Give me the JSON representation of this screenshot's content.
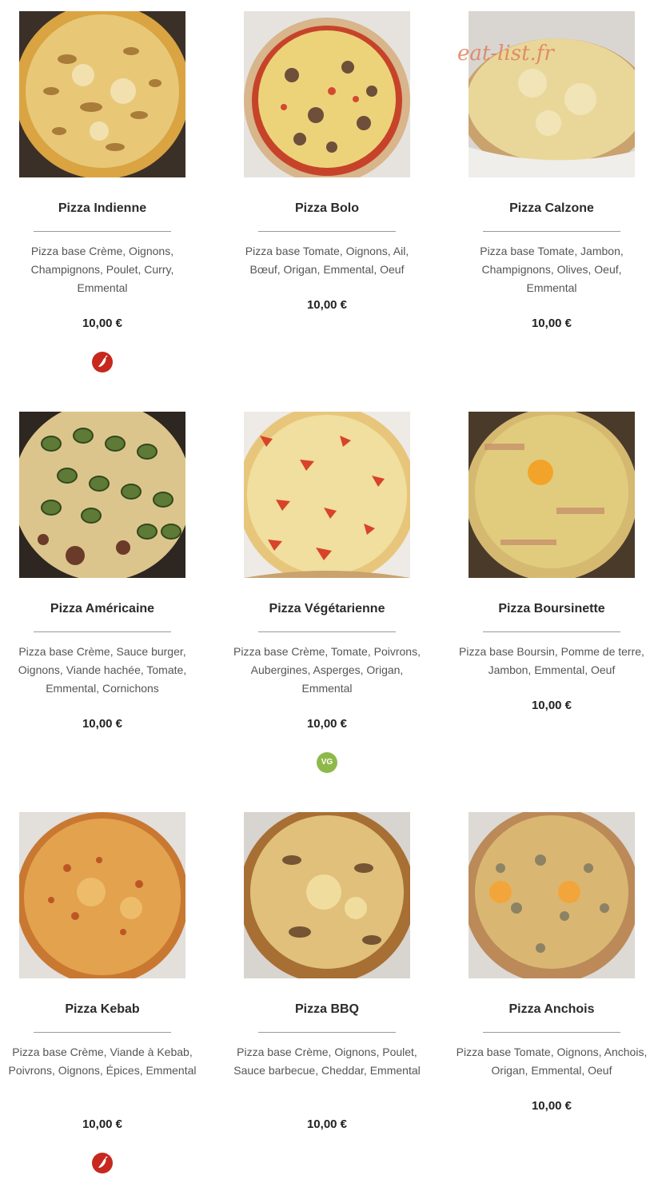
{
  "watermark": "eat-list.fr",
  "colors": {
    "spicy_badge": "#c7281e",
    "veg_badge": "#8fb84a"
  },
  "pizzas": [
    {
      "name": "Pizza Indienne",
      "description": "Pizza base Crème, Oignons, Champignons, Poulet, Curry, Emmental",
      "price": "10,00 €",
      "badge": "chili-icon"
    },
    {
      "name": "Pizza Bolo",
      "description": "Pizza base Tomate, Oignons, Ail, Bœuf, Origan, Emmental, Oeuf",
      "price": "10,00 €",
      "badge": null
    },
    {
      "name": "Pizza Calzone",
      "description": "Pizza base Tomate, Jambon, Champignons, Olives, Oeuf, Emmental",
      "price": "10,00 €",
      "badge": null
    },
    {
      "name": "Pizza Américaine",
      "description": "Pizza base Crème, Sauce burger, Oignons, Viande hachée, Tomate, Emmental, Cornichons",
      "price": "10,00 €",
      "badge": null
    },
    {
      "name": "Pizza Végétarienne",
      "description": "Pizza base Crème, Tomate, Poivrons, Aubergines, Asperges, Origan, Emmental",
      "price": "10,00 €",
      "badge": "vg-icon",
      "badge_text": "VG"
    },
    {
      "name": "Pizza Boursinette",
      "description": "Pizza base Boursin, Pomme de terre, Jambon, Emmental, Oeuf",
      "price": "10,00 €",
      "badge": null
    },
    {
      "name": "Pizza Kebab",
      "description": "Pizza base Crème, Viande à Kebab, Poivrons, Oignons, Épices, Emmental",
      "price": "10,00 €",
      "badge": "chili-icon"
    },
    {
      "name": "Pizza BBQ",
      "description": "Pizza base Crème, Oignons, Poulet, Sauce barbecue, Cheddar, Emmental",
      "price": "10,00 €",
      "badge": null
    },
    {
      "name": "Pizza Anchois",
      "description": "Pizza base Tomate, Oignons, Anchois, Origan, Emmental, Oeuf",
      "price": "10,00 €",
      "badge": null
    }
  ]
}
